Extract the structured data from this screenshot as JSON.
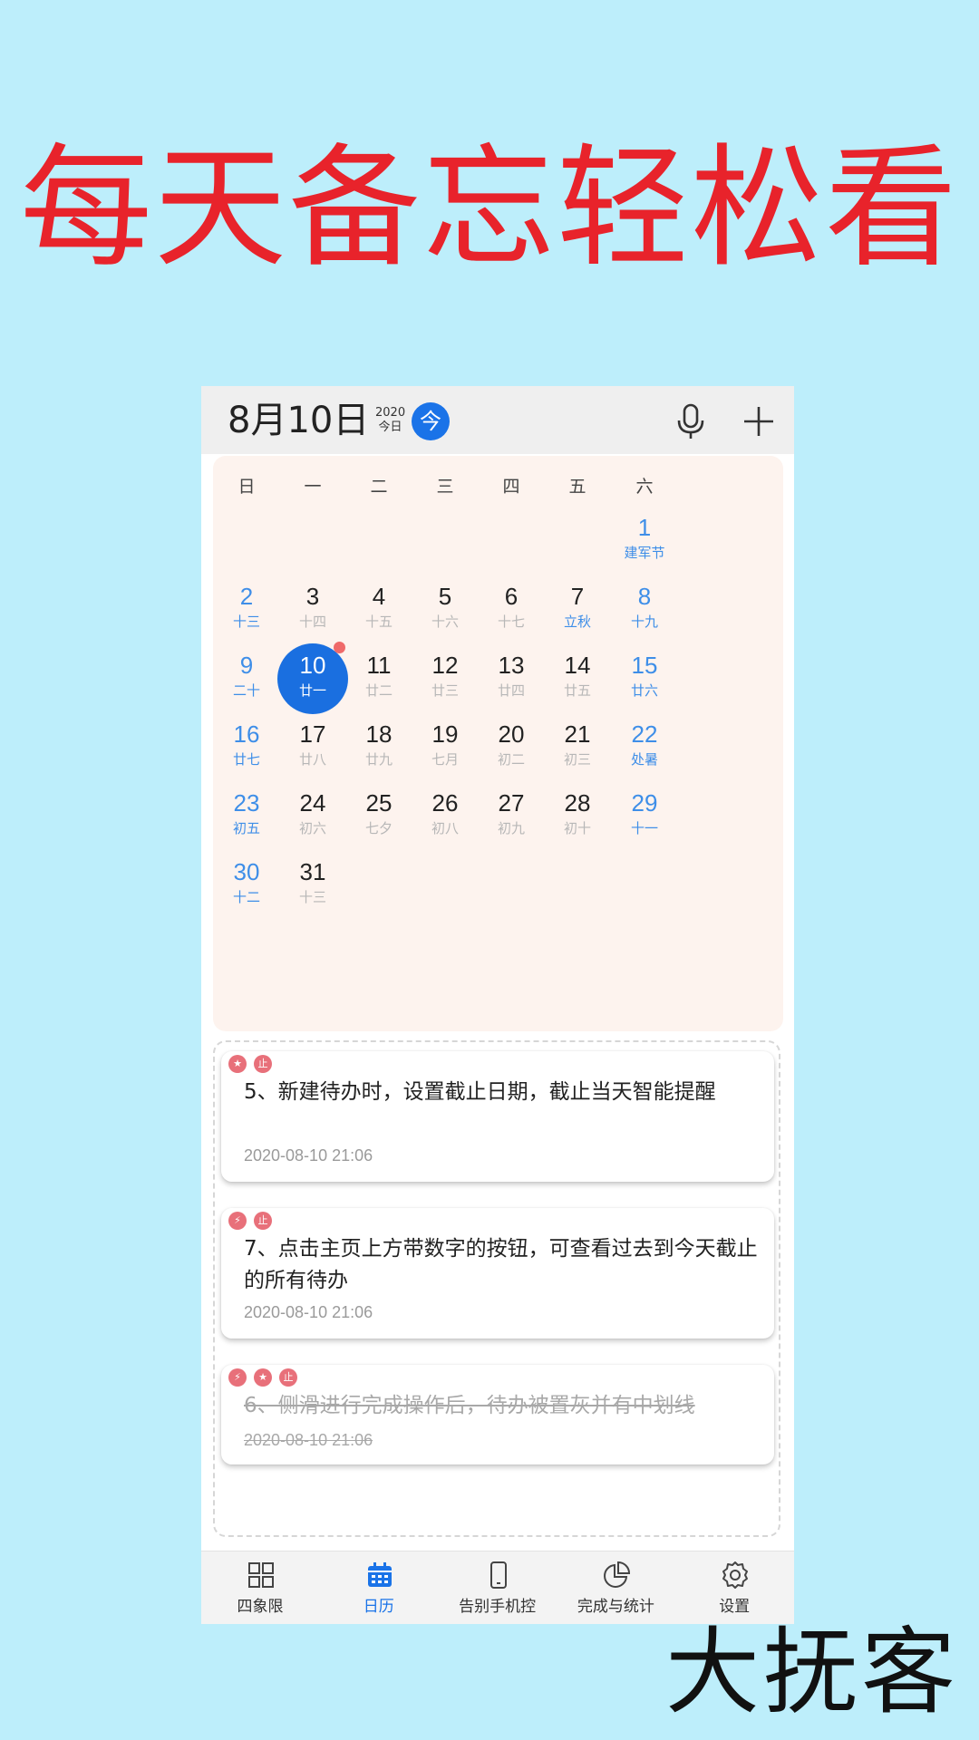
{
  "headline": "每天备忘轻松看",
  "watermark": "大抚客",
  "header": {
    "date": "8月10日",
    "year": "2020",
    "today_label": "今日",
    "today_button": "今"
  },
  "calendar": {
    "weekdays": [
      "日",
      "一",
      "二",
      "三",
      "四",
      "五",
      "六"
    ],
    "weeks": [
      [
        null,
        null,
        null,
        null,
        null,
        null,
        {
          "num": "1",
          "lunar": "建军节"
        }
      ],
      [
        {
          "num": "2",
          "lunar": "十三"
        },
        {
          "num": "3",
          "lunar": "十四"
        },
        {
          "num": "4",
          "lunar": "十五"
        },
        {
          "num": "5",
          "lunar": "十六"
        },
        {
          "num": "6",
          "lunar": "十七"
        },
        {
          "num": "7",
          "lunar": "立秋"
        },
        {
          "num": "8",
          "lunar": "十九"
        }
      ],
      [
        {
          "num": "9",
          "lunar": "二十"
        },
        {
          "num": "10",
          "lunar": "廿一"
        },
        {
          "num": "11",
          "lunar": "廿二"
        },
        {
          "num": "12",
          "lunar": "廿三"
        },
        {
          "num": "13",
          "lunar": "廿四"
        },
        {
          "num": "14",
          "lunar": "廿五"
        },
        {
          "num": "15",
          "lunar": "廿六"
        }
      ],
      [
        {
          "num": "16",
          "lunar": "廿七"
        },
        {
          "num": "17",
          "lunar": "廿八"
        },
        {
          "num": "18",
          "lunar": "廿九"
        },
        {
          "num": "19",
          "lunar": "七月"
        },
        {
          "num": "20",
          "lunar": "初二"
        },
        {
          "num": "21",
          "lunar": "初三"
        },
        {
          "num": "22",
          "lunar": "处暑"
        }
      ],
      [
        {
          "num": "23",
          "lunar": "初五"
        },
        {
          "num": "24",
          "lunar": "初六"
        },
        {
          "num": "25",
          "lunar": "七夕"
        },
        {
          "num": "26",
          "lunar": "初八"
        },
        {
          "num": "27",
          "lunar": "初九"
        },
        {
          "num": "28",
          "lunar": "初十"
        },
        {
          "num": "29",
          "lunar": "十一"
        }
      ],
      [
        {
          "num": "30",
          "lunar": "十二"
        },
        {
          "num": "31",
          "lunar": "十三"
        },
        null,
        null,
        null,
        null,
        null
      ]
    ],
    "selected_day": "10",
    "festival_days": [
      "7"
    ],
    "dot_days": [
      "10"
    ],
    "weekend_color": "#3e8ee8",
    "selected_color": "#1a6fe0"
  },
  "todos": [
    {
      "badges": [
        "★",
        "止"
      ],
      "text": "5、新建待办时，设置截止日期，截止当天智能提醒",
      "time": "2020-08-10 21:06",
      "done": false
    },
    {
      "badges": [
        "⚡",
        "止"
      ],
      "text": "7、点击主页上方带数字的按钮，可查看过去到今天截止的所有待办",
      "time": "2020-08-10 21:06",
      "done": false
    },
    {
      "badges": [
        "⚡",
        "★",
        "止"
      ],
      "text": "6、侧滑进行完成操作后，待办被置灰并有中划线",
      "time": "2020-08-10 21:06",
      "done": true
    }
  ],
  "tabs": [
    {
      "label": "四象限",
      "icon": "grid-icon",
      "active": false
    },
    {
      "label": "日历",
      "icon": "calendar-icon",
      "active": true
    },
    {
      "label": "告别手机控",
      "icon": "phone-icon",
      "active": false
    },
    {
      "label": "完成与统计",
      "icon": "pie-chart-icon",
      "active": false
    },
    {
      "label": "设置",
      "icon": "gear-icon",
      "active": false
    }
  ],
  "colors": {
    "accent": "#1a73e8",
    "headline": "#e8232b",
    "background": "#bdeefb",
    "badge": "#e8707a"
  }
}
